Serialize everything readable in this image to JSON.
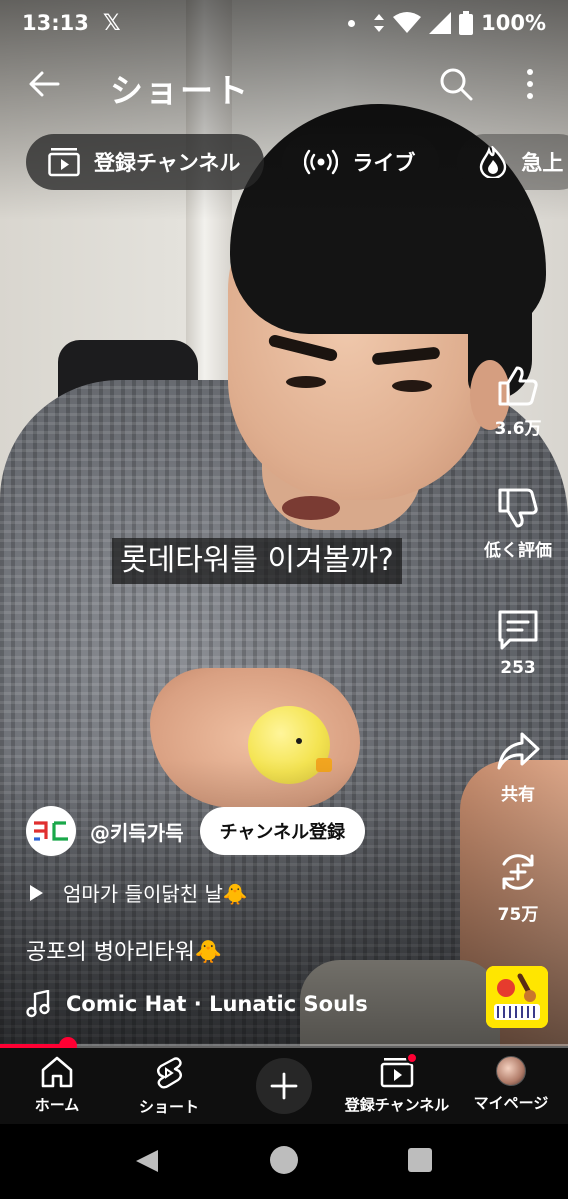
{
  "status_bar": {
    "time": "13:13",
    "app_icon": "x-logo-icon",
    "battery": "100%"
  },
  "header": {
    "title": "ショート",
    "back_icon": "arrow-left-icon",
    "search_icon": "search-icon",
    "more_icon": "more-vertical-icon"
  },
  "chips": [
    {
      "label": "登録チャンネル",
      "icon": "subscriptions-icon",
      "active": true
    },
    {
      "label": "ライブ",
      "icon": "live-icon",
      "active": false
    },
    {
      "label": "急上",
      "icon": "trending-icon",
      "active": false
    }
  ],
  "video": {
    "caption": "롯데타워를 이겨볼까?"
  },
  "actions": {
    "like_count": "3.6万",
    "dislike_label": "低く評価",
    "comment_count": "253",
    "share_label": "共有",
    "remix_count": "75万"
  },
  "channel": {
    "handle": "@키득가득",
    "subscribe_label": "チャンネル登録",
    "avatar_text": "ㅋㄷ"
  },
  "playlist": {
    "title": "엄마가 들이닭친 날🐥"
  },
  "description": "공포의 병아리타워🐥",
  "music": {
    "text": "Comic Hat · Lunatic Souls"
  },
  "progress": {
    "fraction": 0.12
  },
  "bottom_nav": [
    {
      "label": "ホーム",
      "icon": "home-icon"
    },
    {
      "label": "ショート",
      "icon": "shorts-icon"
    },
    {
      "label": "",
      "icon": "plus-icon"
    },
    {
      "label": "登録チャンネル",
      "icon": "subscriptions-icon",
      "badge": true
    },
    {
      "label": "マイページ",
      "icon": "avatar-icon"
    }
  ],
  "colors": {
    "accent": "#ff0033",
    "nav_background": "#0f0f0f",
    "chip_active": "#282828"
  }
}
